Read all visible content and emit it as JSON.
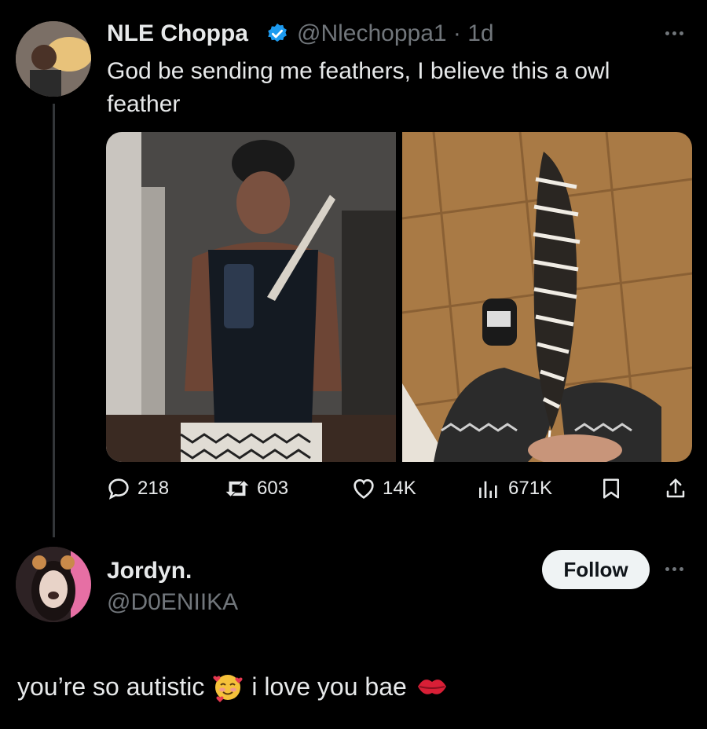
{
  "tweet": {
    "author_name": "NLE Choppa",
    "author_handle": "@Nlechoppa1 · 1d",
    "text": "God be sending me feathers, I believe this a owl feather",
    "more_icon": "more-horizontal-icon",
    "verified_icon": "verified-badge-icon",
    "verified_color": "#1d9bf0",
    "stats": {
      "replies": "218",
      "retweets": "603",
      "likes": "14K",
      "views": "671K"
    }
  },
  "reply": {
    "author_name": "Jordyn.",
    "author_handle": "@D0ENIIKA",
    "follow_label": "Follow",
    "text_part1": "you’re so autistic",
    "text_part2": "i love you bae",
    "emoji1": "smiling-face-with-hearts-icon",
    "emoji2": "kiss-mark-icon"
  },
  "colors": {
    "background": "#000000",
    "text": "#e7e9ea",
    "muted": "#71767b",
    "follow_bg": "#eff3f4"
  }
}
